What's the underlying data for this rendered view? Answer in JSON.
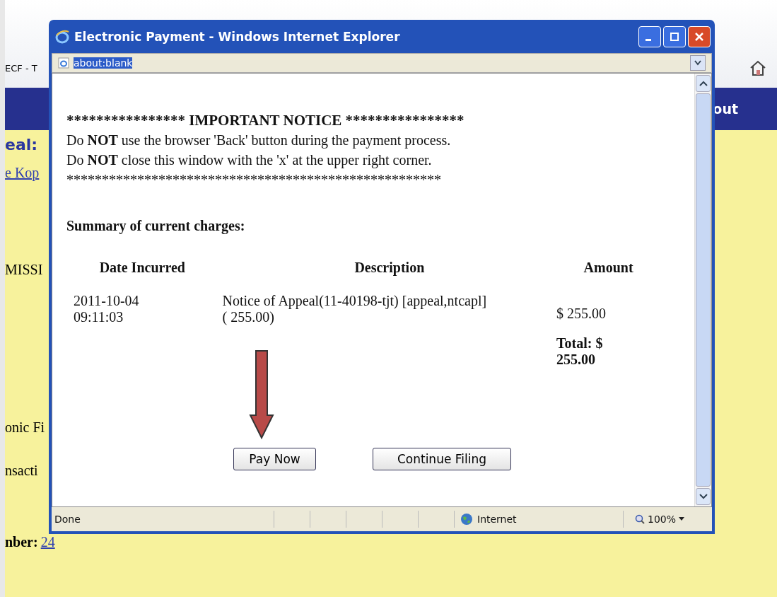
{
  "background_page": {
    "tab_title": "ECF - T",
    "nav_text": "out",
    "heading": "eal:",
    "link": "e Kop",
    "fragments": [
      "MISSI",
      "onic Fi",
      "nsacti"
    ],
    "number_label": "nber:",
    "number_link": "24"
  },
  "popup": {
    "title": "Electronic Payment - Windows Internet Explorer",
    "address": "about:blank",
    "notice_title": "**************** IMPORTANT NOTICE ****************",
    "notice_lines": [
      "Do **NOT** use the browser 'Back' button during the payment process.",
      "Do **NOT** close this window with the 'x' at the upper right corner."
    ],
    "notice_rule": "*****************************************************",
    "summary_heading": "Summary of current charges:",
    "table": {
      "columns": [
        "Date Incurred",
        "Description",
        "Amount"
      ],
      "rows": [
        {
          "date": "2011-10-04 09:11:03",
          "description": "Notice of Appeal(11-40198-tjt) [appeal,ntcapl] ( 255.00)",
          "amount": "$ 255.00"
        }
      ],
      "total": "Total: $ 255.00"
    },
    "buttons": [
      "Pay Now",
      "Continue Filing"
    ],
    "status_bar": {
      "text": "Done",
      "zone": "Internet",
      "zoom": "100%"
    }
  }
}
